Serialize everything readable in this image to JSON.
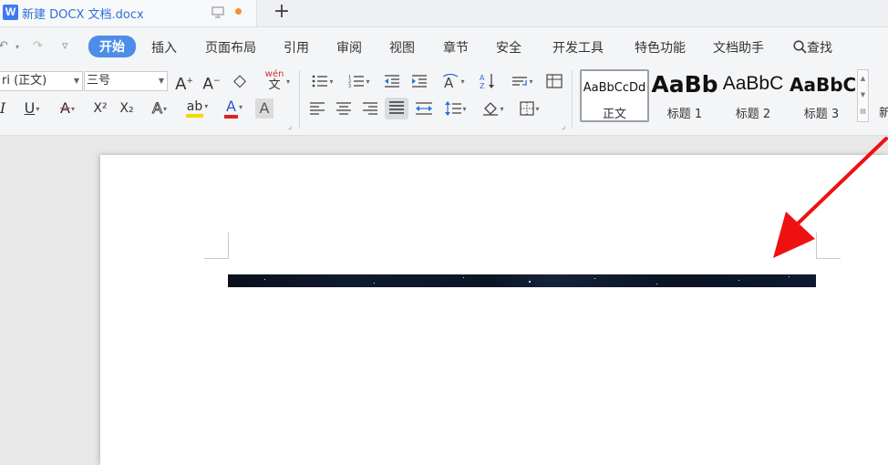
{
  "tab": {
    "logo_letter": "W",
    "title": "新建 DOCX 文档.docx",
    "new_tab": "+",
    "accent": "#3d7bf0",
    "unsaved_color": "#f0923a"
  },
  "quick_access": {
    "undo": "↶",
    "redo": "↷",
    "customize": "▿"
  },
  "menu": {
    "items": [
      "开始",
      "插入",
      "页面布局",
      "引用",
      "审阅",
      "视图",
      "章节",
      "安全",
      "开发工具",
      "特色功能",
      "文档助手"
    ],
    "search_label": "查找",
    "active_index": 0
  },
  "ribbon": {
    "font_name": "ri (正文)",
    "font_size": "三号",
    "grow_font": "A",
    "shrink_font": "A",
    "clear_format": "◇",
    "phonetic": "wén",
    "phonetic_char": "文",
    "italic": "I",
    "underline": "U",
    "strike": "A",
    "superscript": "X²",
    "subscript": "X₂",
    "text_effect": "A",
    "highlight": "ab",
    "font_color": "A",
    "char_shading": "A"
  },
  "styles": {
    "items": [
      {
        "sample": "AaBbCcDd",
        "name": "正文"
      },
      {
        "sample": "AaBb",
        "name": "标题 1"
      },
      {
        "sample": "AaBbC",
        "name": "标题 2"
      },
      {
        "sample": "AaBbC",
        "name": "标题 3"
      }
    ],
    "cut_label": "新"
  },
  "colors": {
    "arrow": "#ee1111",
    "highlight_bar": "#f5d800",
    "font_color_bar": "#e02020"
  }
}
